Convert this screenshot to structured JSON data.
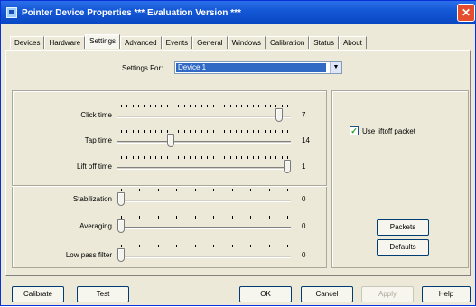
{
  "window": {
    "title": "Pointer Device Properties *** Evaluation Version ***",
    "close_glyph": "✕"
  },
  "tabs": [
    {
      "label": "Devices",
      "active": false
    },
    {
      "label": "Hardware",
      "active": false
    },
    {
      "label": "Settings",
      "active": true
    },
    {
      "label": "Advanced",
      "active": false
    },
    {
      "label": "Events",
      "active": false
    },
    {
      "label": "General",
      "active": false
    },
    {
      "label": "Windows",
      "active": false
    },
    {
      "label": "Calibration",
      "active": false
    },
    {
      "label": "Status",
      "active": false
    },
    {
      "label": "About",
      "active": false
    }
  ],
  "settings_for": {
    "label": "Settings For:",
    "value": "Device 1",
    "dropdown_glyph": "▼"
  },
  "sliders_top": [
    {
      "label": "Click time",
      "value": "7",
      "level": 0.95
    },
    {
      "label": "Tap time",
      "value": "14",
      "level": 0.3
    },
    {
      "label": "Lift off time",
      "value": "1",
      "level": 1.0
    }
  ],
  "sliders_bottom": [
    {
      "label": "Stabilization",
      "value": "0",
      "level": 0.0
    },
    {
      "label": "Averaging",
      "value": "0",
      "level": 0.0
    },
    {
      "label": "Low pass filter",
      "value": "0",
      "level": 0.0
    }
  ],
  "options": {
    "use_lift_off_packet": {
      "label": "Use liftoff packet",
      "checked": true,
      "check_glyph": "✓"
    }
  },
  "side_buttons": {
    "packets": "Packets",
    "defaults": "Defaults"
  },
  "bottom_buttons": {
    "calibrate": "Calibrate",
    "test": "Test",
    "ok": "OK",
    "cancel": "Cancel",
    "apply": "Apply",
    "help": "Help"
  },
  "colors": {
    "titlebar": "#0a47c2",
    "window_bg": "#ece9d8",
    "selection": "#316ac5",
    "close": "#e44d2e"
  }
}
